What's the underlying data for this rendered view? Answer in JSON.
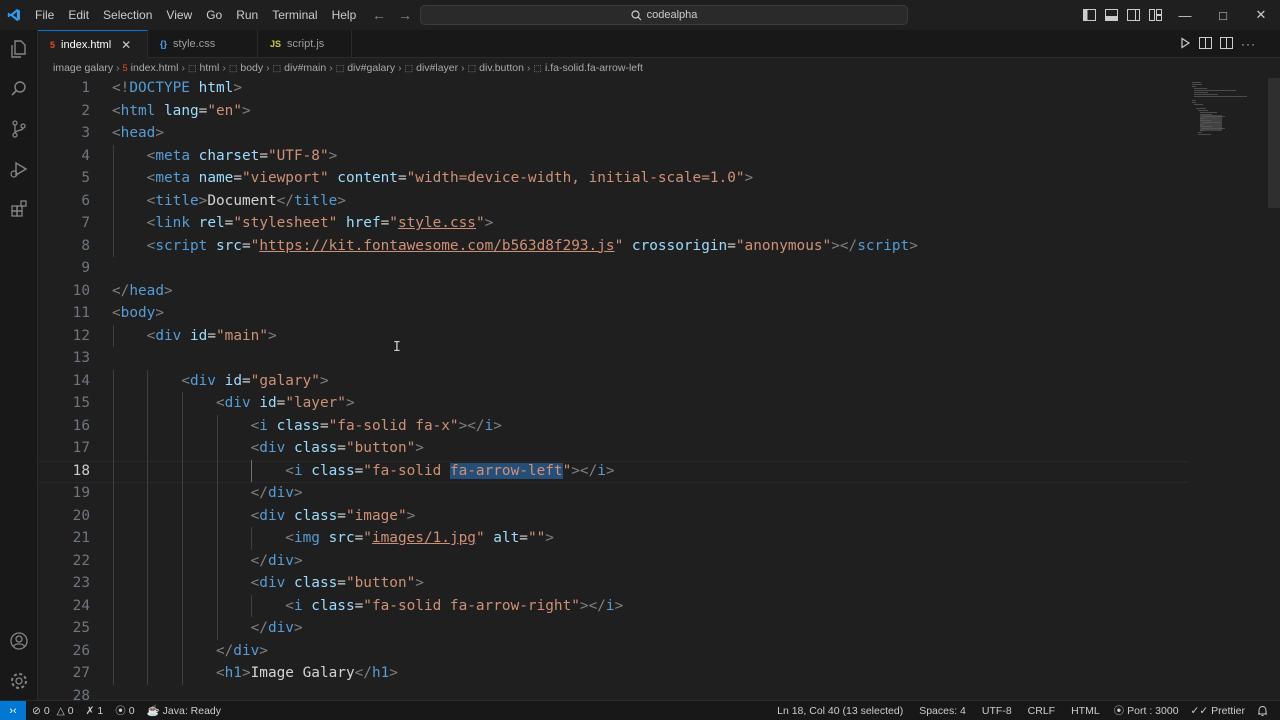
{
  "menu": [
    "File",
    "Edit",
    "Selection",
    "View",
    "Go",
    "Run",
    "Terminal",
    "Help"
  ],
  "command_center": {
    "text": "codealpha"
  },
  "tabs": [
    {
      "label": "index.html",
      "icon": "html-file-icon",
      "glyph": "5",
      "color": "#e44d26",
      "active": true
    },
    {
      "label": "style.css",
      "icon": "css-file-icon",
      "glyph": "{}",
      "color": "#42a5f5",
      "active": false
    },
    {
      "label": "script.js",
      "icon": "js-file-icon",
      "glyph": "JS",
      "color": "#cbcb41",
      "active": false
    }
  ],
  "breadcrumb": [
    "image galary",
    "index.html",
    "html",
    "body",
    "div#main",
    "div#galary",
    "div#layer",
    "div.button",
    "i.fa-solid.fa-arrow-left"
  ],
  "editor": {
    "current_line": 18,
    "lines": [
      {
        "n": "1",
        "indent": 0,
        "parts": [
          [
            "br",
            "<!"
          ],
          [
            "tag",
            "DOCTYPE"
          ],
          [
            "txt",
            " "
          ],
          [
            "attr",
            "html"
          ],
          [
            "br",
            ">"
          ]
        ]
      },
      {
        "n": "2",
        "indent": 0,
        "parts": [
          [
            "br",
            "<"
          ],
          [
            "tag",
            "html"
          ],
          [
            "txt",
            " "
          ],
          [
            "attr",
            "lang"
          ],
          [
            "txt",
            "="
          ],
          [
            "str",
            "\"en\""
          ],
          [
            "br",
            ">"
          ]
        ]
      },
      {
        "n": "3",
        "indent": 0,
        "parts": [
          [
            "br",
            "<"
          ],
          [
            "tag",
            "head"
          ],
          [
            "br",
            ">"
          ]
        ]
      },
      {
        "n": "4",
        "indent": 1,
        "parts": [
          [
            "br",
            "<"
          ],
          [
            "tag",
            "meta"
          ],
          [
            "txt",
            " "
          ],
          [
            "attr",
            "charset"
          ],
          [
            "txt",
            "="
          ],
          [
            "str",
            "\"UTF-8\""
          ],
          [
            "br",
            ">"
          ]
        ]
      },
      {
        "n": "5",
        "indent": 1,
        "parts": [
          [
            "br",
            "<"
          ],
          [
            "tag",
            "meta"
          ],
          [
            "txt",
            " "
          ],
          [
            "attr",
            "name"
          ],
          [
            "txt",
            "="
          ],
          [
            "str",
            "\"viewport\""
          ],
          [
            "txt",
            " "
          ],
          [
            "attr",
            "content"
          ],
          [
            "txt",
            "="
          ],
          [
            "str",
            "\"width=device-width, initial-scale=1.0\""
          ],
          [
            "br",
            ">"
          ]
        ]
      },
      {
        "n": "6",
        "indent": 1,
        "parts": [
          [
            "br",
            "<"
          ],
          [
            "tag",
            "title"
          ],
          [
            "br",
            ">"
          ],
          [
            "txt",
            "Document"
          ],
          [
            "br",
            "</"
          ],
          [
            "tag",
            "title"
          ],
          [
            "br",
            ">"
          ]
        ]
      },
      {
        "n": "7",
        "indent": 1,
        "parts": [
          [
            "br",
            "<"
          ],
          [
            "tag",
            "link"
          ],
          [
            "txt",
            " "
          ],
          [
            "attr",
            "rel"
          ],
          [
            "txt",
            "="
          ],
          [
            "str",
            "\"stylesheet\""
          ],
          [
            "txt",
            " "
          ],
          [
            "attr",
            "href"
          ],
          [
            "txt",
            "="
          ],
          [
            "str",
            "\""
          ],
          [
            "stru",
            "style.css"
          ],
          [
            "str",
            "\""
          ],
          [
            "br",
            ">"
          ]
        ]
      },
      {
        "n": "8",
        "indent": 1,
        "parts": [
          [
            "br",
            "<"
          ],
          [
            "tag",
            "script"
          ],
          [
            "txt",
            " "
          ],
          [
            "attr",
            "src"
          ],
          [
            "txt",
            "="
          ],
          [
            "str",
            "\""
          ],
          [
            "stru",
            "https://kit.fontawesome.com/b563d8f293.js"
          ],
          [
            "str",
            "\""
          ],
          [
            "txt",
            " "
          ],
          [
            "attr",
            "crossorigin"
          ],
          [
            "txt",
            "="
          ],
          [
            "str",
            "\"anonymous\""
          ],
          [
            "br",
            "></"
          ],
          [
            "tag",
            "script"
          ],
          [
            "br",
            ">"
          ]
        ]
      },
      {
        "n": "9",
        "indent": 0,
        "parts": []
      },
      {
        "n": "10",
        "indent": 0,
        "parts": [
          [
            "br",
            "</"
          ],
          [
            "tag",
            "head"
          ],
          [
            "br",
            ">"
          ]
        ]
      },
      {
        "n": "11",
        "indent": 0,
        "parts": [
          [
            "br",
            "<"
          ],
          [
            "tag",
            "body"
          ],
          [
            "br",
            ">"
          ]
        ]
      },
      {
        "n": "12",
        "indent": 1,
        "parts": [
          [
            "br",
            "<"
          ],
          [
            "tag",
            "div"
          ],
          [
            "txt",
            " "
          ],
          [
            "attr",
            "id"
          ],
          [
            "txt",
            "="
          ],
          [
            "str",
            "\"main\""
          ],
          [
            "br",
            ">"
          ]
        ]
      },
      {
        "n": "13",
        "indent": 0,
        "parts": []
      },
      {
        "n": "14",
        "indent": 2,
        "parts": [
          [
            "br",
            "<"
          ],
          [
            "tag",
            "div"
          ],
          [
            "txt",
            " "
          ],
          [
            "attr",
            "id"
          ],
          [
            "txt",
            "="
          ],
          [
            "str",
            "\"galary\""
          ],
          [
            "br",
            ">"
          ]
        ]
      },
      {
        "n": "15",
        "indent": 3,
        "parts": [
          [
            "br",
            "<"
          ],
          [
            "tag",
            "div"
          ],
          [
            "txt",
            " "
          ],
          [
            "attr",
            "id"
          ],
          [
            "txt",
            "="
          ],
          [
            "str",
            "\"layer\""
          ],
          [
            "br",
            ">"
          ]
        ]
      },
      {
        "n": "16",
        "indent": 4,
        "parts": [
          [
            "br",
            "<"
          ],
          [
            "tag",
            "i"
          ],
          [
            "txt",
            " "
          ],
          [
            "attr",
            "class"
          ],
          [
            "txt",
            "="
          ],
          [
            "str",
            "\"fa-solid fa-x\""
          ],
          [
            "br",
            "></"
          ],
          [
            "tag",
            "i"
          ],
          [
            "br",
            ">"
          ]
        ]
      },
      {
        "n": "17",
        "indent": 4,
        "parts": [
          [
            "br",
            "<"
          ],
          [
            "tag",
            "div"
          ],
          [
            "txt",
            " "
          ],
          [
            "attr",
            "class"
          ],
          [
            "txt",
            "="
          ],
          [
            "str",
            "\"button\""
          ],
          [
            "br",
            ">"
          ]
        ]
      },
      {
        "n": "18",
        "indent": 5,
        "parts": [
          [
            "br",
            "<"
          ],
          [
            "tag",
            "i"
          ],
          [
            "txt",
            " "
          ],
          [
            "attr",
            "class"
          ],
          [
            "txt",
            "="
          ],
          [
            "str",
            "\"fa-solid "
          ],
          [
            "strsel",
            "fa-arrow-left"
          ],
          [
            "str",
            "\""
          ],
          [
            "br",
            "></"
          ],
          [
            "tag",
            "i"
          ],
          [
            "br",
            ">"
          ]
        ]
      },
      {
        "n": "19",
        "indent": 4,
        "parts": [
          [
            "br",
            "</"
          ],
          [
            "tag",
            "div"
          ],
          [
            "br",
            ">"
          ]
        ]
      },
      {
        "n": "20",
        "indent": 4,
        "parts": [
          [
            "br",
            "<"
          ],
          [
            "tag",
            "div"
          ],
          [
            "txt",
            " "
          ],
          [
            "attr",
            "class"
          ],
          [
            "txt",
            "="
          ],
          [
            "str",
            "\"image\""
          ],
          [
            "br",
            ">"
          ]
        ]
      },
      {
        "n": "21",
        "indent": 5,
        "parts": [
          [
            "br",
            "<"
          ],
          [
            "tag",
            "img"
          ],
          [
            "txt",
            " "
          ],
          [
            "attr",
            "src"
          ],
          [
            "txt",
            "="
          ],
          [
            "str",
            "\""
          ],
          [
            "stru",
            "images/1.jpg"
          ],
          [
            "str",
            "\""
          ],
          [
            "txt",
            " "
          ],
          [
            "attr",
            "alt"
          ],
          [
            "txt",
            "="
          ],
          [
            "str",
            "\"\""
          ],
          [
            "br",
            ">"
          ]
        ]
      },
      {
        "n": "22",
        "indent": 4,
        "parts": [
          [
            "br",
            "</"
          ],
          [
            "tag",
            "div"
          ],
          [
            "br",
            ">"
          ]
        ]
      },
      {
        "n": "23",
        "indent": 4,
        "parts": [
          [
            "br",
            "<"
          ],
          [
            "tag",
            "div"
          ],
          [
            "txt",
            " "
          ],
          [
            "attr",
            "class"
          ],
          [
            "txt",
            "="
          ],
          [
            "str",
            "\"button\""
          ],
          [
            "br",
            ">"
          ]
        ]
      },
      {
        "n": "24",
        "indent": 5,
        "parts": [
          [
            "br",
            "<"
          ],
          [
            "tag",
            "i"
          ],
          [
            "txt",
            " "
          ],
          [
            "attr",
            "class"
          ],
          [
            "txt",
            "="
          ],
          [
            "str",
            "\"fa-solid fa-arrow-right\""
          ],
          [
            "br",
            "></"
          ],
          [
            "tag",
            "i"
          ],
          [
            "br",
            ">"
          ]
        ]
      },
      {
        "n": "25",
        "indent": 4,
        "parts": [
          [
            "br",
            "</"
          ],
          [
            "tag",
            "div"
          ],
          [
            "br",
            ">"
          ]
        ]
      },
      {
        "n": "26",
        "indent": 3,
        "parts": [
          [
            "br",
            "</"
          ],
          [
            "tag",
            "div"
          ],
          [
            "br",
            ">"
          ]
        ]
      },
      {
        "n": "27",
        "indent": 3,
        "parts": [
          [
            "br",
            "<"
          ],
          [
            "tag",
            "h1"
          ],
          [
            "br",
            ">"
          ],
          [
            "txt",
            "Image Galary"
          ],
          [
            "br",
            "</"
          ],
          [
            "tag",
            "h1"
          ],
          [
            "br",
            ">"
          ]
        ]
      },
      {
        "n": "28",
        "indent": 0,
        "parts": []
      }
    ]
  },
  "status": {
    "errors": "0",
    "warnings": "0",
    "ports": "1",
    "remote": "0",
    "java": "Java: Ready",
    "position": "Ln 18, Col 40 (13 selected)",
    "spaces": "Spaces: 4",
    "encoding": "UTF-8",
    "eol": "CRLF",
    "language": "HTML",
    "port": "Port : 3000",
    "prettier": "Prettier"
  },
  "colors": {
    "accent": "#0078d4",
    "tag": "#569cd6",
    "attr": "#9cdcfe",
    "string": "#ce9178",
    "selection": "#264f78"
  }
}
